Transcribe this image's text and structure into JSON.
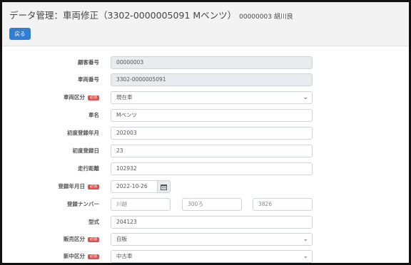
{
  "header": {
    "title": "データ管理：車両修正（3302-0000005091 Mベンツ）",
    "subtitle": "00000003 胡川良"
  },
  "back_button": "戻る",
  "required_badge": "必須",
  "fields": {
    "customer_no": {
      "label": "顧客番号",
      "value": "00000003"
    },
    "vehicle_no": {
      "label": "車両番号",
      "value": "3302-0000005091"
    },
    "vehicle_type": {
      "label": "車両区分",
      "value": "現在車"
    },
    "car_name": {
      "label": "車名",
      "value": "Mベンツ"
    },
    "first_reg_ym": {
      "label": "初度登録年月",
      "value": "202003"
    },
    "first_reg_day": {
      "label": "初度登録日",
      "value": "23"
    },
    "mileage": {
      "label": "走行距離",
      "value": "102932"
    },
    "reg_date": {
      "label": "登録年月日",
      "value": "2022-10-26"
    },
    "reg_number": {
      "label": "登録ナンバー",
      "part1": "川越",
      "part2": "300ろ",
      "part3": "3826"
    },
    "model": {
      "label": "型式",
      "value": "204123"
    },
    "sales_type": {
      "label": "販売区分",
      "value": "自販"
    },
    "new_used": {
      "label": "新中区分",
      "value": "中古車"
    }
  },
  "icons": {
    "chevron": "chevron-down-icon",
    "calendar": "calendar-icon"
  }
}
